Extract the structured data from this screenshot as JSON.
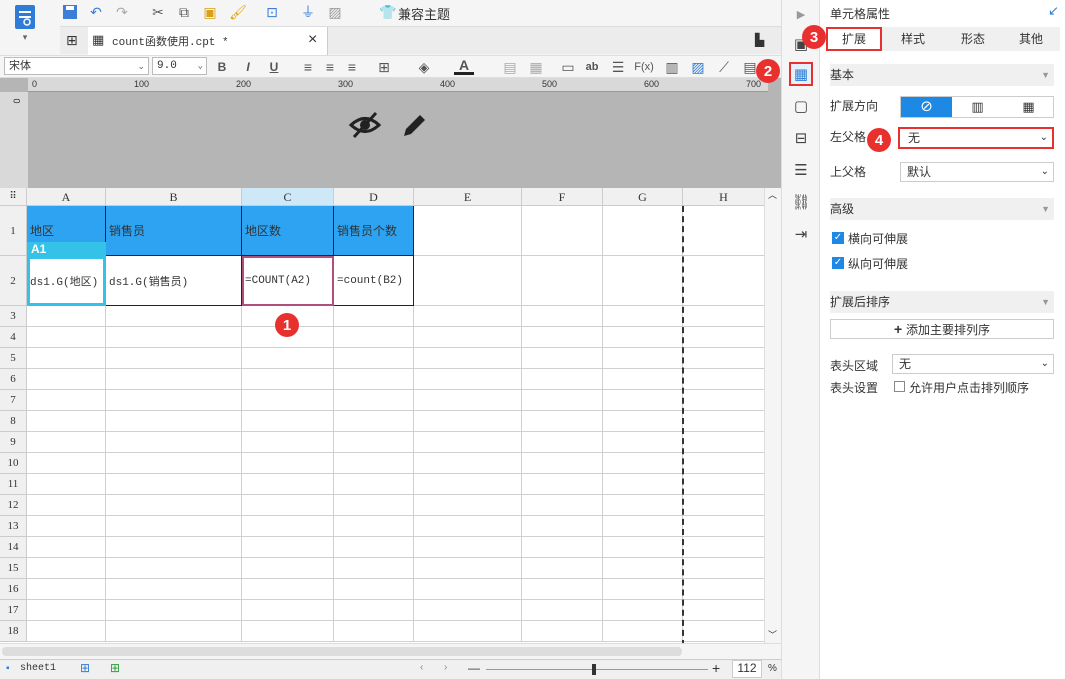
{
  "toolbar": {
    "compat_theme_label": "兼容主题",
    "icons": [
      "save-icon",
      "undo-icon",
      "redo-icon",
      "cut-icon",
      "copy-icon",
      "paste-icon",
      "format-brush-icon",
      "preview-icon",
      "plugin-icon",
      "disabled-icon",
      "shirt-icon"
    ]
  },
  "tab": {
    "filename": "count函数使用.cpt *",
    "close": "×"
  },
  "format": {
    "font": "宋体",
    "size": "9.0",
    "bold": "B",
    "italic": "I",
    "underline": "U"
  },
  "ruler": {
    "h_ticks": [
      "0",
      "100",
      "200",
      "300",
      "400",
      "500",
      "600",
      "700"
    ],
    "v_tick": "0"
  },
  "grid": {
    "corner": "⠿",
    "columns": [
      "A",
      "B",
      "C",
      "D",
      "E",
      "F",
      "G",
      "H"
    ],
    "rows": [
      "1",
      "2",
      "3",
      "4",
      "5",
      "6",
      "7",
      "8",
      "9",
      "10",
      "11",
      "12",
      "13",
      "14",
      "15",
      "16",
      "17",
      "18"
    ],
    "cells": {
      "A1": "地区",
      "B1": "销售员",
      "C1": "地区数",
      "D1": "销售员个数",
      "A2": "ds1.G(地区)",
      "B2": "ds1.G(销售员)",
      "C2": "=COUNT(A2)",
      "D2": "=count(B2)"
    },
    "selected_label": "A1"
  },
  "status": {
    "sheet": "sheet1",
    "zoom": "112",
    "percent": "%",
    "minus": "—",
    "plus": "+"
  },
  "panel": {
    "title": "单元格属性",
    "tabs": [
      "扩展",
      "样式",
      "形态",
      "其他"
    ],
    "basic_section": "基本",
    "expand_direction_label": "扩展方向",
    "left_parent_label": "左父格",
    "left_parent_value": "无",
    "top_parent_label": "上父格",
    "top_parent_value": "默认",
    "advanced_section": "高级",
    "h_expand_label": "横向可伸展",
    "v_expand_label": "纵向可伸展",
    "sort_section": "扩展后排序",
    "add_sort_button": "添加主要排列序",
    "header_area_label": "表头区域",
    "header_area_value": "无",
    "header_setting_label": "表头设置",
    "allow_sort_label": "允许用户点击排列顺序"
  },
  "badges": [
    "1",
    "2",
    "3",
    "4"
  ],
  "colors": {
    "header_blue": "#2ea3f2",
    "badge_red": "#e8302f",
    "accent": "#1e88e5"
  }
}
